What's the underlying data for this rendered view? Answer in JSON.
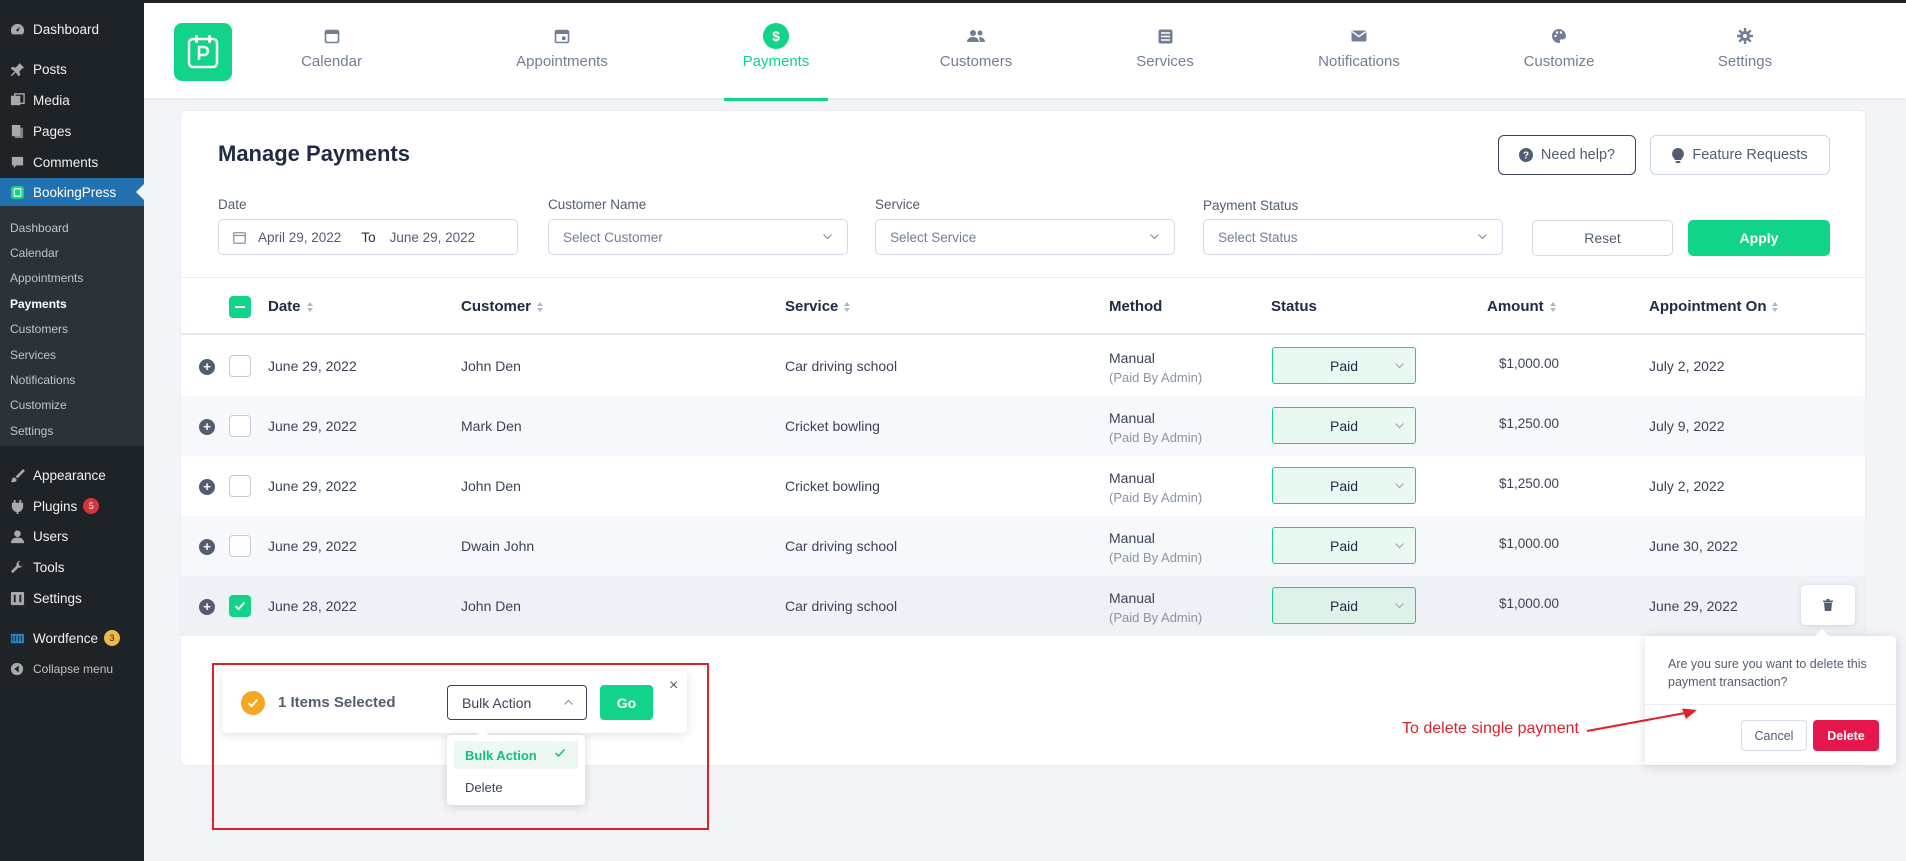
{
  "wp_menu": {
    "top": [
      {
        "label": "Dashboard",
        "icon": "dashboard-icon"
      },
      {
        "label": "Posts",
        "icon": "pin-icon"
      },
      {
        "label": "Media",
        "icon": "media-icon"
      },
      {
        "label": "Pages",
        "icon": "pages-icon"
      },
      {
        "label": "Comments",
        "icon": "comment-icon"
      },
      {
        "label": "BookingPress",
        "icon": "bookingpress-icon"
      }
    ],
    "sub": [
      "Dashboard",
      "Calendar",
      "Appointments",
      "Payments",
      "Customers",
      "Services",
      "Notifications",
      "Customize",
      "Settings"
    ],
    "bottom": [
      {
        "label": "Appearance",
        "icon": "brush-icon"
      },
      {
        "label": "Plugins",
        "icon": "plug-icon",
        "badge": "5"
      },
      {
        "label": "Users",
        "icon": "user-icon"
      },
      {
        "label": "Tools",
        "icon": "wrench-icon"
      },
      {
        "label": "Settings",
        "icon": "settings-icon"
      },
      {
        "label": "Wordfence",
        "icon": "wordfence-icon",
        "badge": "3"
      },
      {
        "label": "Collapse menu",
        "icon": "collapse-icon"
      }
    ]
  },
  "nav": {
    "tabs": [
      "Calendar",
      "Appointments",
      "Payments",
      "Customers",
      "Services",
      "Notifications",
      "Customize",
      "Settings"
    ],
    "active": "Payments"
  },
  "page": {
    "title": "Manage Payments",
    "help_label": "Need help?",
    "feature_label": "Feature Requests"
  },
  "filters": {
    "date_label": "Date",
    "date_from": "April 29, 2022",
    "date_to_label": "To",
    "date_to": "June 29, 2022",
    "customer_label": "Customer Name",
    "customer_placeholder": "Select Customer",
    "service_label": "Service",
    "service_placeholder": "Select Service",
    "status_label": "Payment Status",
    "status_placeholder": "Select Status",
    "reset_label": "Reset",
    "apply_label": "Apply"
  },
  "table": {
    "headers": [
      "Date",
      "Customer",
      "Service",
      "Method",
      "Status",
      "Amount",
      "Appointment On"
    ],
    "rows": [
      {
        "date": "June 29, 2022",
        "customer": "John Den",
        "service": "Car driving school",
        "method": "Manual",
        "method_sub": "(Paid By Admin)",
        "status": "Paid",
        "amount": "$1,000.00",
        "appointment_on": "July 2, 2022"
      },
      {
        "date": "June 29, 2022",
        "customer": "Mark Den",
        "service": "Cricket bowling",
        "method": "Manual",
        "method_sub": "(Paid By Admin)",
        "status": "Paid",
        "amount": "$1,250.00",
        "appointment_on": "July 9, 2022"
      },
      {
        "date": "June 29, 2022",
        "customer": "John Den",
        "service": "Cricket bowling",
        "method": "Manual",
        "method_sub": "(Paid By Admin)",
        "status": "Paid",
        "amount": "$1,250.00",
        "appointment_on": "July 2, 2022"
      },
      {
        "date": "June 29, 2022",
        "customer": "Dwain John",
        "service": "Car driving school",
        "method": "Manual",
        "method_sub": "(Paid By Admin)",
        "status": "Paid",
        "amount": "$1,000.00",
        "appointment_on": "June 30, 2022"
      },
      {
        "date": "June 28, 2022",
        "customer": "John Den",
        "service": "Car driving school",
        "method": "Manual",
        "method_sub": "(Paid By Admin)",
        "status": "Paid",
        "amount": "$1,000.00",
        "appointment_on": "June 29, 2022",
        "selected": true
      }
    ]
  },
  "bulk": {
    "count_label": "1 Items Selected",
    "select_value": "Bulk Action",
    "go_label": "Go",
    "close": "×",
    "options": [
      "Bulk Action",
      "Delete"
    ]
  },
  "delete_popover": {
    "message": "Are you sure you want to delete this payment transaction?",
    "cancel_label": "Cancel",
    "delete_label": "Delete"
  },
  "annotation": "To delete single payment",
  "colors": {
    "accent": "#12d488",
    "danger": "#e6174d",
    "annotation": "#e0202a",
    "wp_sidebar": "#1d2327",
    "wp_current": "#2271b1"
  }
}
